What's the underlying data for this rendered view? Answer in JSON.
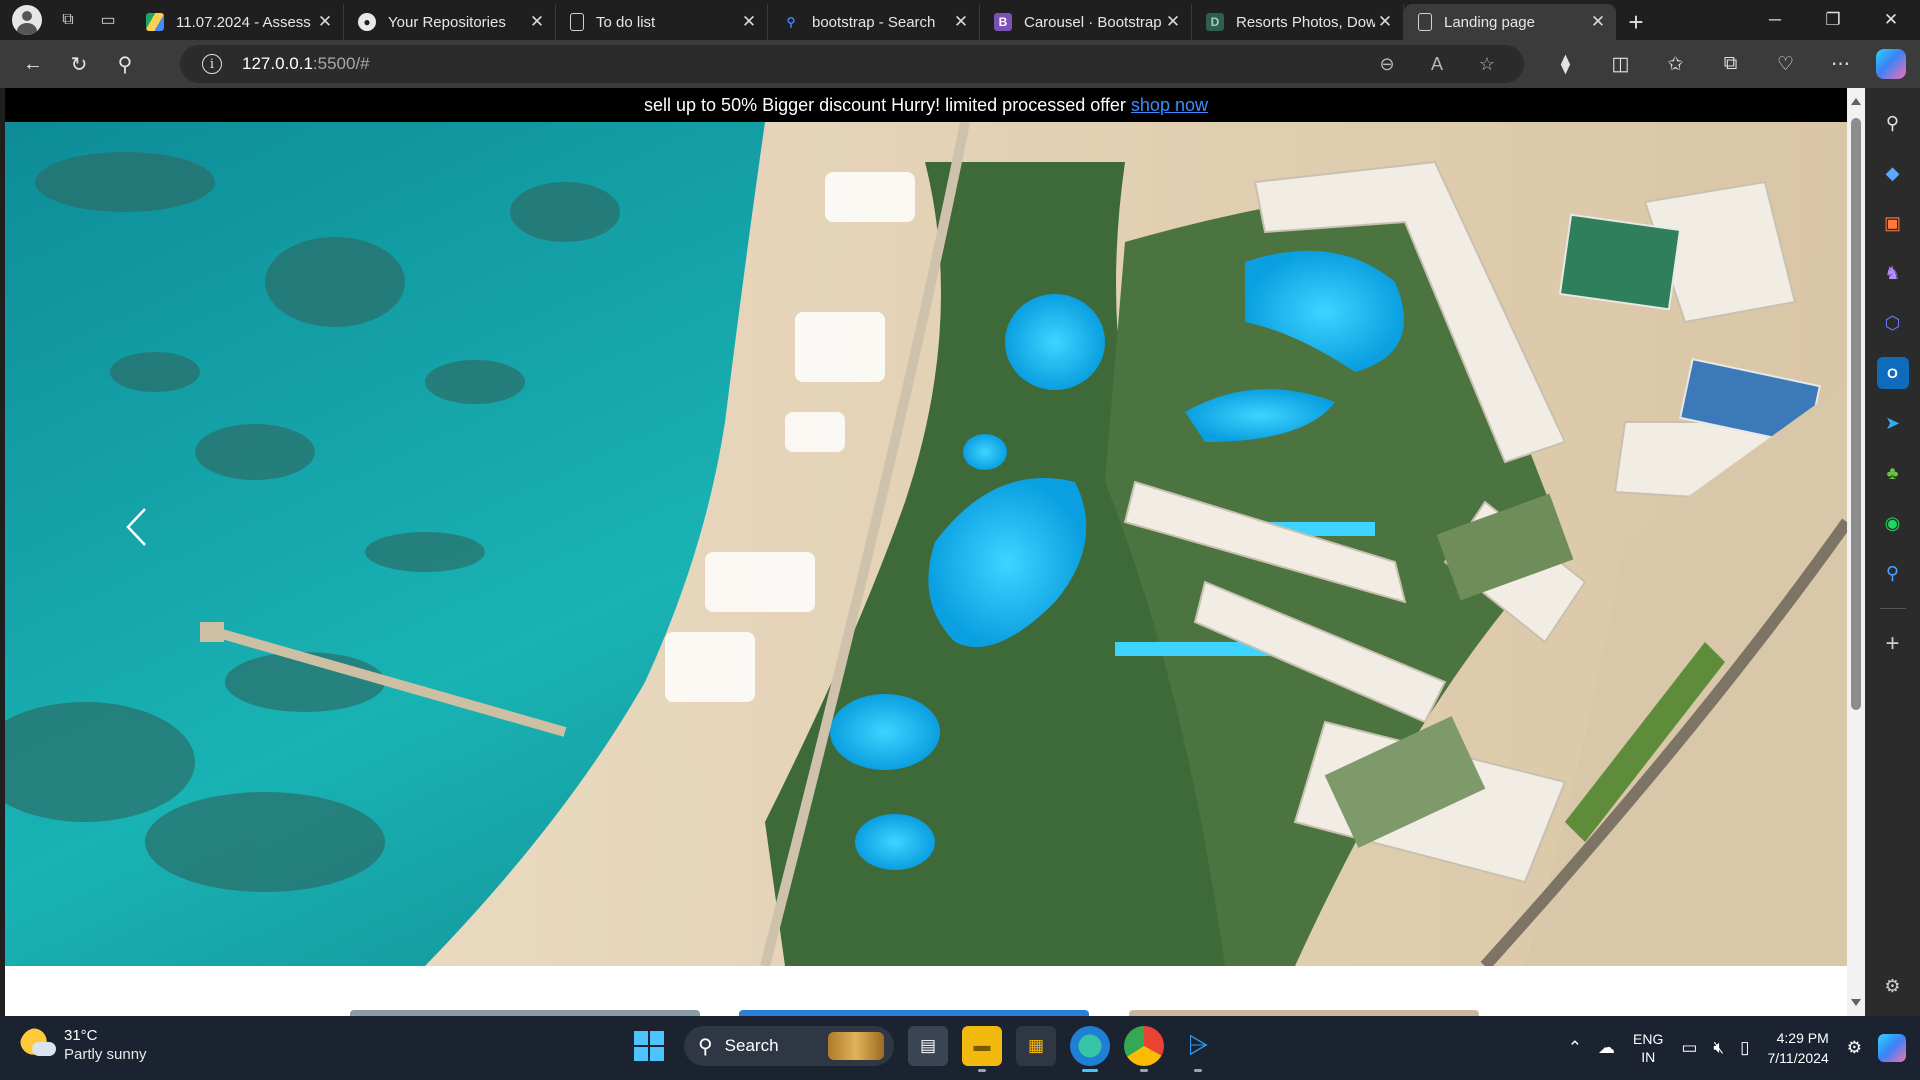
{
  "browser": {
    "tabs": [
      {
        "title": "11.07.2024 - Assess",
        "icon": "google-drive-icon"
      },
      {
        "title": "Your Repositories",
        "icon": "github-icon"
      },
      {
        "title": "To do list",
        "icon": "page-icon"
      },
      {
        "title": "bootstrap - Search",
        "icon": "search-icon"
      },
      {
        "title": "Carousel · Bootstrap",
        "icon": "bootstrap-icon"
      },
      {
        "title": "Resorts Photos, Dow",
        "icon": "photo-site-icon"
      },
      {
        "title": "Landing page",
        "icon": "page-icon",
        "active": true
      }
    ],
    "new_tab": "+",
    "url_host": "127.0.0.1",
    "url_rest": ":5500/#"
  },
  "page": {
    "offer_text": "sell up to 50% Bigger discount Hurry! limited processed offer",
    "offer_link": "shop now",
    "carousel_prev": "‹"
  },
  "colors": {
    "accent": "#3b8cff",
    "offer_bg": "#000000",
    "taskbar": "#1c2330",
    "browser_chrome": "#3b3b3b"
  },
  "taskbar": {
    "temperature": "31°C",
    "weather": "Partly sunny",
    "search_placeholder": "Search",
    "language_top": "ENG",
    "language_bottom": "IN",
    "time": "4:29 PM",
    "date": "7/11/2024"
  }
}
